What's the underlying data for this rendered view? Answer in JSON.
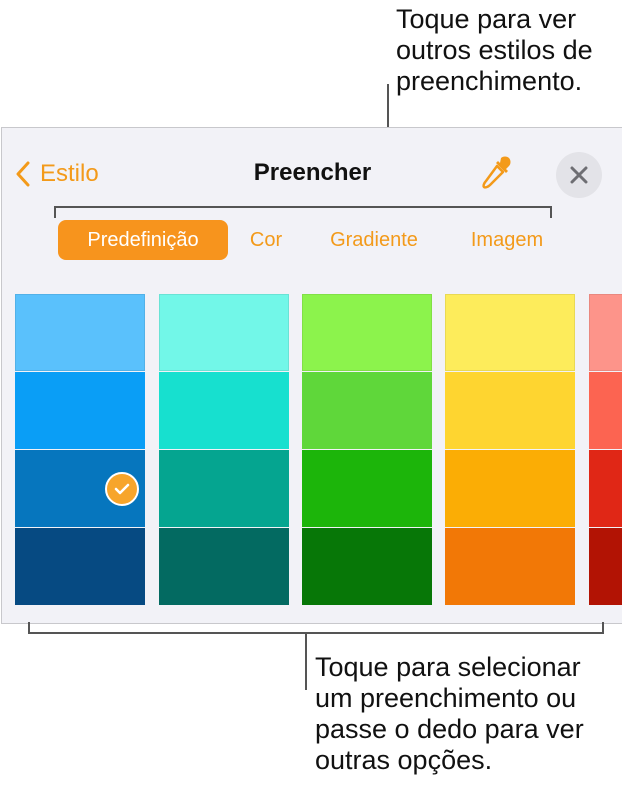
{
  "callouts": {
    "top": "Toque para ver\noutros estilos de\npreenchimento.",
    "bottom": "Toque para selecionar\num preenchimento ou\npasse o dedo para ver\noutras opções."
  },
  "header": {
    "back_label": "Estilo",
    "title": "Preencher"
  },
  "tabs": [
    {
      "label": "Predefinição",
      "active": true
    },
    {
      "label": "Cor",
      "active": false
    },
    {
      "label": "Gradiente",
      "active": false
    },
    {
      "label": "Imagem",
      "active": false
    }
  ],
  "colors": {
    "accent": "#f7941d",
    "swatches": [
      [
        "#5ac1fc",
        "#0a9ef6",
        "#0676be",
        "#064a82"
      ],
      [
        "#72f7e8",
        "#17e0cf",
        "#05a590",
        "#036a61"
      ],
      [
        "#8cf34c",
        "#5fd73a",
        "#1cb50a",
        "#077707"
      ],
      [
        "#fdec5b",
        "#fed530",
        "#fbad05",
        "#f27806"
      ],
      [
        "#fd948a",
        "#fc6451",
        "#e02716",
        "#b21304"
      ]
    ]
  },
  "selected_swatch": {
    "column": 0,
    "row": 2
  }
}
